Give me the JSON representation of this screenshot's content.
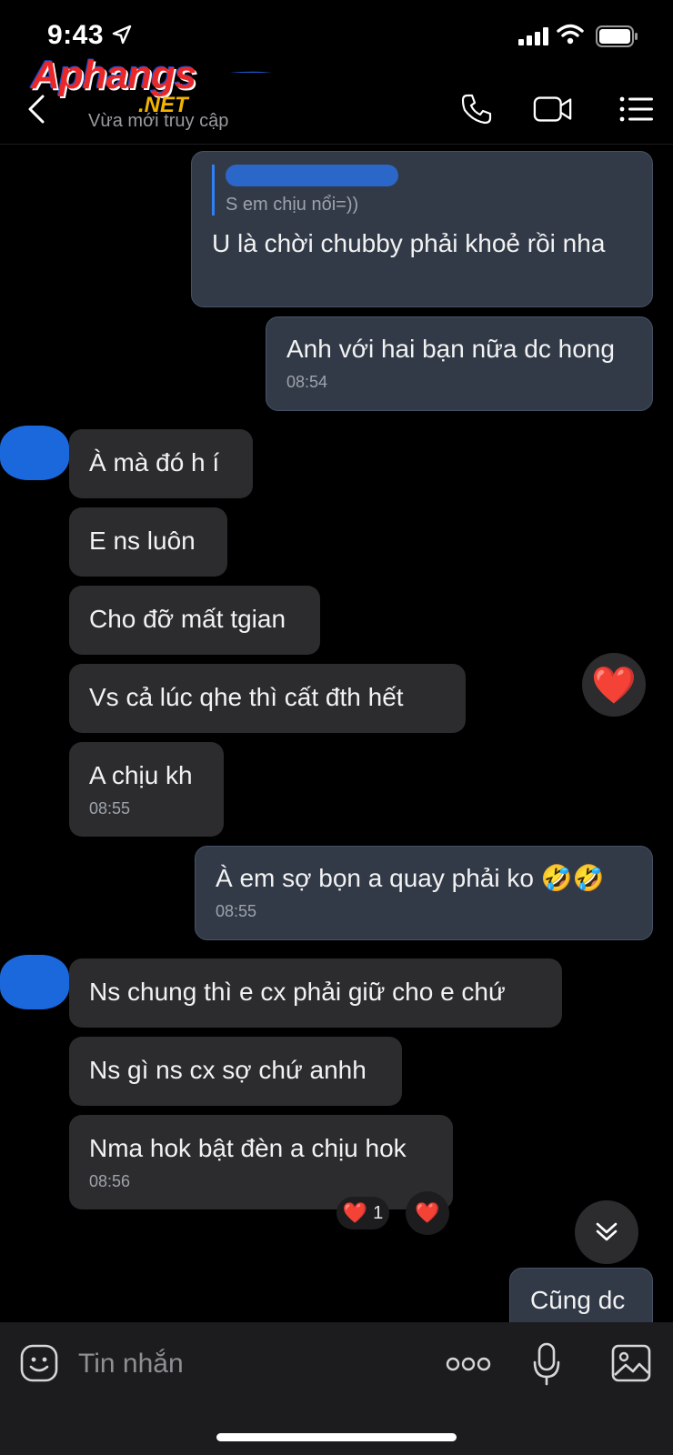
{
  "status_bar": {
    "time": "9:43"
  },
  "header": {
    "logo_main": "Aphangs",
    "logo_net": ".NET",
    "presence": "Vừa mới truy cập"
  },
  "messages": [
    {
      "dir": "out",
      "quote_text": "S em chịu nổi=))",
      "text": "U là chời chubby phải khoẻ rồi nha"
    },
    {
      "dir": "out",
      "text": "Anh với hai bạn nữa dc hong",
      "time": "08:54"
    },
    {
      "dir": "in",
      "text": "À mà đó h í"
    },
    {
      "dir": "in",
      "text": "E ns luôn"
    },
    {
      "dir": "in",
      "text": "Cho đỡ mất tgian"
    },
    {
      "dir": "in",
      "text": " Vs cả lúc qhe thì cất đth hết"
    },
    {
      "dir": "in",
      "text": "A chịu kh",
      "time": "08:55"
    },
    {
      "dir": "out",
      "text": "À em sợ bọn a quay phải ko 🤣🤣",
      "time": "08:55"
    },
    {
      "dir": "in",
      "text": "Ns chung thì e cx phải giữ cho e chứ"
    },
    {
      "dir": "in",
      "text": "Ns gì ns cx sợ chứ anhh"
    },
    {
      "dir": "in",
      "text": "Nma hok bật đèn a chịu hok",
      "time": "08:56"
    },
    {
      "dir": "out",
      "text": "Cũng dc"
    }
  ],
  "reactions": {
    "float_heart": "❤️",
    "chip_heart": "❤️",
    "chip_count": "1",
    "chip2_heart": "❤️"
  },
  "composer": {
    "placeholder": "Tin nhắn"
  },
  "colors": {
    "background": "#000000",
    "incoming_bubble": "#2c2c2e",
    "outgoing_bubble": "#323a48",
    "accent_blue": "#2f7ff6",
    "heart_red": "#ff2b3d"
  }
}
